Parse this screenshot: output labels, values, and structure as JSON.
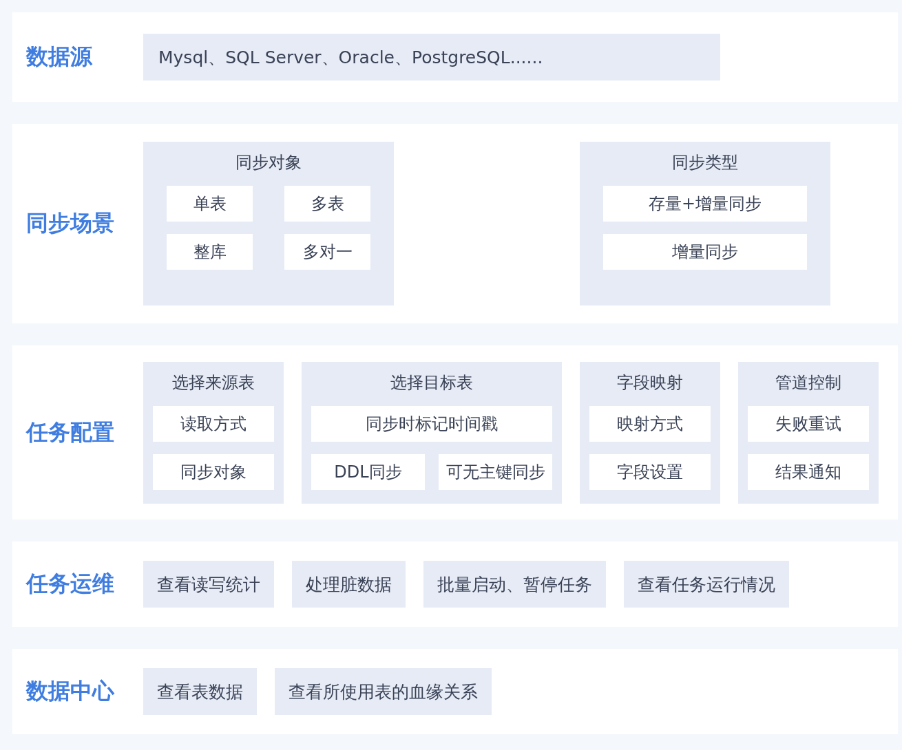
{
  "sections": [
    {
      "label": "数据源",
      "kind": "single",
      "items": [
        "Mysql、SQL Server、Oracle、PostgreSQL......"
      ]
    },
    {
      "label": "同步场景",
      "kind": "groups-spaced",
      "groups": [
        {
          "title": "同步对象",
          "rows": [
            [
              "单表",
              "多表"
            ],
            [
              "整库",
              "多对一"
            ]
          ]
        },
        {
          "title": "同步类型",
          "rows": [
            [
              "存量+增量同步"
            ],
            [
              "增量同步"
            ]
          ]
        }
      ]
    },
    {
      "label": "任务配置",
      "kind": "groups",
      "groups": [
        {
          "title": "选择来源表",
          "rows": [
            [
              "读取方式"
            ],
            [
              "同步对象"
            ]
          ]
        },
        {
          "title": "选择目标表",
          "rows": [
            [
              "同步时标记时间戳"
            ],
            [
              "DDL同步",
              "可无主键同步"
            ]
          ]
        },
        {
          "title": "字段映射",
          "rows": [
            [
              "映射方式"
            ],
            [
              "字段设置"
            ]
          ]
        },
        {
          "title": "管道控制",
          "rows": [
            [
              "失败重试"
            ],
            [
              "结果通知"
            ]
          ]
        }
      ]
    },
    {
      "label": "任务运维",
      "kind": "buttons",
      "items": [
        "查看读写统计",
        "处理脏数据",
        "批量启动、暂停任务",
        "查看任务运行情况"
      ]
    },
    {
      "label": "数据中心",
      "kind": "buttons",
      "items": [
        "查看表数据",
        "查看所使用表的血缘关系"
      ]
    }
  ]
}
